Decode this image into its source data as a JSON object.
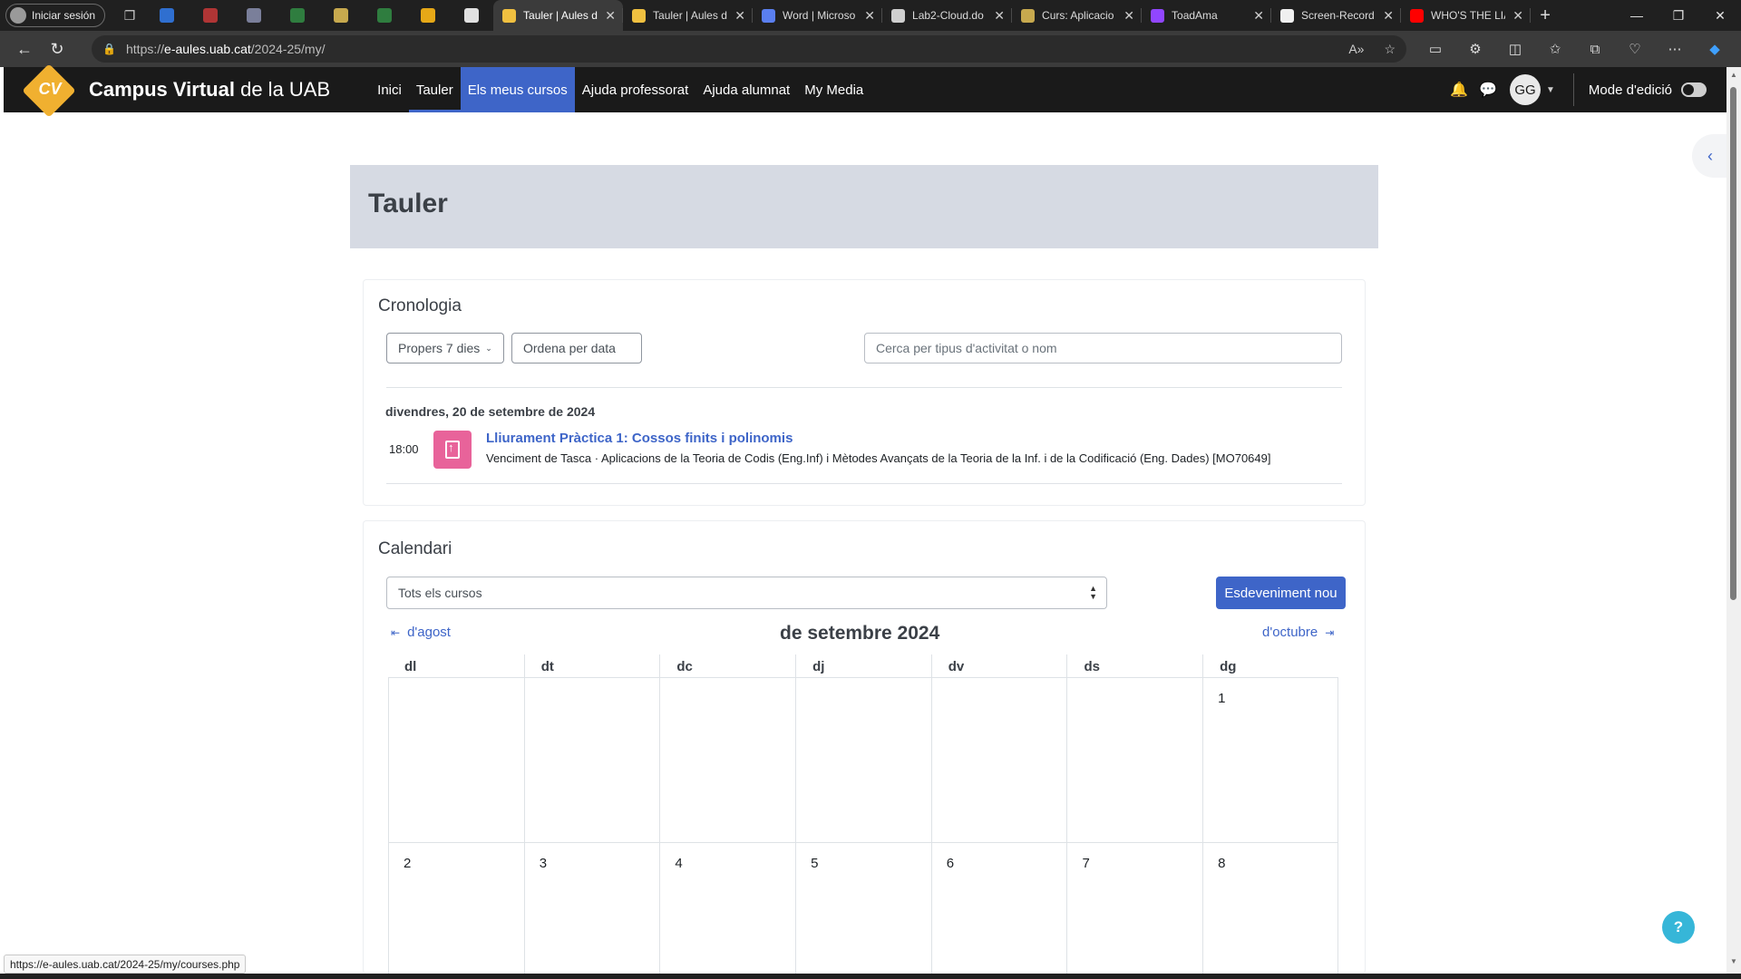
{
  "browser": {
    "profile_label": "Iniciar sesión",
    "pinned_colors": [
      "#2f6fd0",
      "#b03535",
      "#7a7f9a",
      "#2f7d3f",
      "#c7a94e",
      "#2f7d3f",
      "#e6a817",
      "#e0e0e0"
    ],
    "tabs": [
      {
        "title": "Tauler | Aules d",
        "icon_color": "#f0c040",
        "active": true
      },
      {
        "title": "Tauler | Aules d",
        "icon_color": "#f0c040",
        "active": false
      },
      {
        "title": "Word | Microso",
        "icon_color": "#5a7ff0",
        "active": false
      },
      {
        "title": "Lab2-Cloud.do",
        "icon_color": "#cfcfcf",
        "active": false
      },
      {
        "title": "Curs: Aplicacio",
        "icon_color": "#c7a94e",
        "active": false
      },
      {
        "title": "ToadAma",
        "icon_color": "#9146ff",
        "active": false
      },
      {
        "title": "Screen-Record",
        "icon_color": "#f0f0f0",
        "active": false
      },
      {
        "title": "WHO'S THE LIA",
        "icon_color": "#ff0000",
        "active": false
      }
    ],
    "url_prefix": "https://",
    "url_host": "e-aules.uab.cat",
    "url_path": "/2024-25/my/",
    "status_url": "https://e-aules.uab.cat/2024-25/my/courses.php"
  },
  "site": {
    "brand_logo_text": "CV",
    "brand_bold": "Campus Virtual",
    "brand_rest": " de la UAB",
    "nav": [
      "Inici",
      "Tauler",
      "Els meus cursos",
      "Ajuda professorat",
      "Ajuda alumnat",
      "My Media"
    ],
    "user_initials": "GG",
    "edit_mode_label": "Mode d'edició",
    "colors": {
      "accent": "#3e65c8",
      "navbar": "#1a1a1a",
      "brand": "#f0b030",
      "activity_icon": "#e8639a"
    }
  },
  "page": {
    "title": "Tauler"
  },
  "timeline": {
    "heading": "Cronologia",
    "filter_label": "Propers 7 dies",
    "sort_label": "Ordena per data",
    "search_placeholder": "Cerca per tipus d'activitat o nom",
    "day": "divendres, 20 de setembre de 2024",
    "event": {
      "time": "18:00",
      "title": "Lliurament Pràctica 1: Cossos finits i polinomis",
      "description": "Venciment de Tasca · Aplicacions de la Teoria de Codis (Eng.Inf) i Mètodes Avançats de la Teoria de la Inf. i de la Codificació (Eng. Dades) [MO70649]"
    }
  },
  "calendar": {
    "heading": "Calendari",
    "course_select": "Tots els cursos",
    "new_event_label": "Esdeveniment nou",
    "prev_label": "d'agost",
    "next_label": "d'octubre",
    "month_label": "de setembre 2024",
    "weekdays": [
      "dl",
      "dt",
      "dc",
      "dj",
      "dv",
      "ds",
      "dg"
    ],
    "weeks": [
      [
        "",
        "",
        "",
        "",
        "",
        "",
        "1"
      ],
      [
        "2",
        "3",
        "4",
        "5",
        "6",
        "7",
        "8"
      ]
    ]
  },
  "help_label": "?"
}
